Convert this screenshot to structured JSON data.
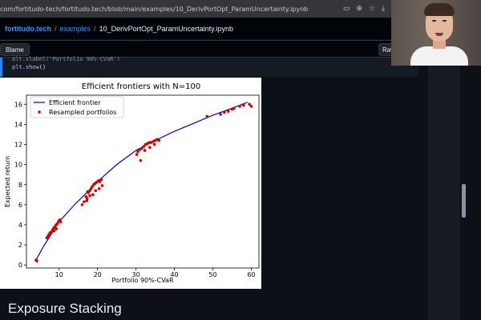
{
  "browser": {
    "url": "com/fortitudo-tech/fortitudo.tech/blob/main/examples/10_DerivPortOpt_ParamUncertainty.ipynb",
    "icons": [
      "screen-cast-icon",
      "zoom-icon",
      "star-icon",
      "download-icon"
    ]
  },
  "repo": {
    "owner": "fortitudo.tech",
    "folder": "examples",
    "file": "10_DerivPortOpt_ParamUncertainty.ipynb",
    "separator": "/"
  },
  "toolbar": {
    "blame_label": "Blame",
    "raw_label": "Raw"
  },
  "code": {
    "line1": "plt.xlabel('Portfolio 90%-CVaR')",
    "line2_fn": "plt.show",
    "line2_args": "()"
  },
  "section_heading": "Exposure Stacking",
  "colors": {
    "frontier": "#0000cc",
    "resampled": "#cc0000",
    "link": "#4493f8"
  },
  "chart_data": {
    "type": "scatter",
    "title": "Efficient frontiers with N=100",
    "xlabel": "Portfolio 90%-CVaR",
    "ylabel": "Expected return",
    "xlim": [
      1.5,
      62
    ],
    "ylim": [
      -0.3,
      16.9
    ],
    "xticks": [
      10,
      20,
      30,
      40,
      50,
      60
    ],
    "yticks": [
      0,
      2,
      4,
      6,
      8,
      10,
      12,
      14,
      16
    ],
    "legend_position": "top-left",
    "grid": false,
    "series": [
      {
        "name": "Efficient frontier",
        "kind": "line",
        "x": [
          4,
          6,
          8,
          10,
          14,
          18,
          20,
          25,
          30,
          35,
          40,
          45,
          50,
          55,
          59
        ],
        "y": [
          0.5,
          1.9,
          3.1,
          4.3,
          6.0,
          7.5,
          8.3,
          10.0,
          11.4,
          12.4,
          13.3,
          14.1,
          14.9,
          15.6,
          16.2
        ]
      },
      {
        "name": "Resampled portfolios",
        "kind": "scatter",
        "x": [
          4,
          4.2,
          6.8,
          7.0,
          7.3,
          7.6,
          8.0,
          8.3,
          8.6,
          8.9,
          9.2,
          9.5,
          9.8,
          10.0,
          10.2,
          10.4,
          8.7,
          9.3,
          16,
          16.5,
          17,
          17.3,
          17.6,
          18,
          18.3,
          18.6,
          19,
          19.3,
          19.6,
          20,
          20.3,
          20.6,
          21,
          17.4,
          18,
          18.8,
          19.5,
          20.4,
          21.2,
          17.2,
          30.2,
          30.5,
          31,
          31.5,
          32,
          32.5,
          33,
          33.5,
          34,
          34.5,
          35,
          35.5,
          36,
          32.3,
          33.6,
          34.8,
          31.2,
          48.5,
          52,
          53,
          54,
          55,
          55.5,
          57,
          58,
          59.5,
          60
        ],
        "y": [
          0.5,
          0.4,
          2.7,
          2.8,
          3.0,
          3.2,
          3.3,
          3.5,
          3.7,
          3.8,
          4.0,
          4.1,
          4.3,
          4.4,
          4.5,
          4.3,
          3.4,
          3.6,
          6.0,
          6.3,
          6.8,
          6.6,
          7.2,
          7.4,
          7.6,
          7.8,
          8.0,
          8.1,
          8.2,
          8.3,
          8.4,
          8.3,
          8.5,
          7.3,
          6.9,
          7.0,
          7.4,
          7.6,
          7.9,
          6.4,
          11.0,
          11.3,
          11.5,
          11.6,
          11.8,
          12.0,
          12.1,
          12.2,
          12.2,
          12.3,
          12.4,
          12.5,
          12.4,
          11.4,
          11.7,
          12.0,
          10.4,
          14.8,
          15.0,
          15.2,
          15.3,
          15.5,
          15.6,
          15.8,
          15.9,
          16.0,
          15.8
        ]
      }
    ]
  }
}
